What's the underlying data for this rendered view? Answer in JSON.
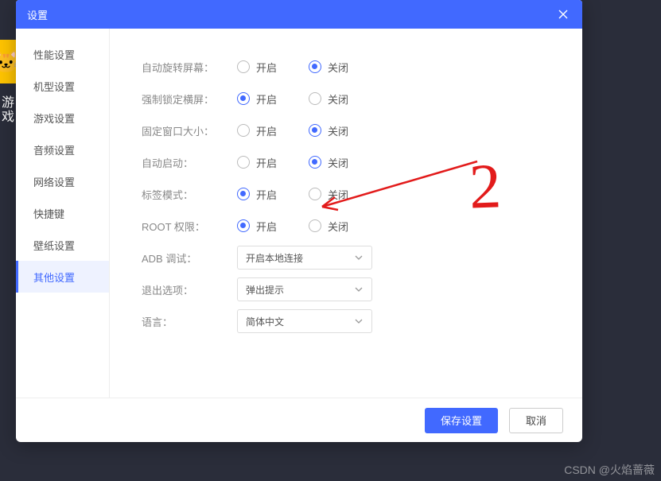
{
  "modal": {
    "title": "设置",
    "sidebar": {
      "items": [
        {
          "label": "性能设置"
        },
        {
          "label": "机型设置"
        },
        {
          "label": "游戏设置"
        },
        {
          "label": "音频设置"
        },
        {
          "label": "网络设置"
        },
        {
          "label": "快捷键"
        },
        {
          "label": "壁纸设置"
        },
        {
          "label": "其他设置"
        }
      ],
      "active_index": 7
    },
    "options": {
      "on_label": "开启",
      "off_label": "关闭",
      "rows": [
        {
          "label": "自动旋转屏幕：",
          "value": "off"
        },
        {
          "label": "强制锁定横屏：",
          "value": "on"
        },
        {
          "label": "固定窗口大小：",
          "value": "off"
        },
        {
          "label": "自动启动：",
          "value": "off"
        },
        {
          "label": "标签模式：",
          "value": "on"
        },
        {
          "label": "ROOT 权限：",
          "value": "on"
        }
      ],
      "selects": [
        {
          "label": "ADB 调试：",
          "value": "开启本地连接"
        },
        {
          "label": "退出选项：",
          "value": "弹出提示"
        },
        {
          "label": "语言：",
          "value": "简体中文"
        }
      ]
    },
    "footer": {
      "save": "保存设置",
      "cancel": "取消"
    }
  },
  "annotation": {
    "digit": "2"
  },
  "watermark": "CSDN @火焰蔷薇",
  "bg_text": "游戏"
}
